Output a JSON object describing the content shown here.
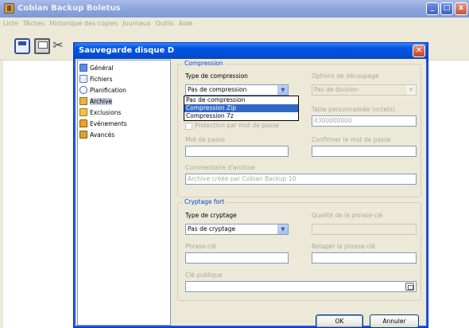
{
  "app": {
    "title": "Cobian Backup Boletus",
    "menu": [
      "Liste",
      "Tâches",
      "Historique des copies",
      "Journaux",
      "Outils",
      "Aide"
    ],
    "window_buttons": [
      "_",
      "□",
      "x"
    ]
  },
  "dialog": {
    "title": "Sauvegarde disque D",
    "close_glyph": "✕",
    "nav": [
      {
        "label": "Général",
        "icon": "general-icon"
      },
      {
        "label": "Fichiers",
        "icon": "files-icon"
      },
      {
        "label": "Planification",
        "icon": "clock-icon"
      },
      {
        "label": "Archive",
        "icon": "archive-icon",
        "selected": true
      },
      {
        "label": "Exclusions",
        "icon": "exclusions-icon"
      },
      {
        "label": "Evénements",
        "icon": "events-icon"
      },
      {
        "label": "Avancés",
        "icon": "advanced-icon"
      }
    ],
    "compression": {
      "legend": "Compression",
      "type_label": "Type de compression",
      "type_value": "Pas de compression",
      "split_label": "Options  de découpage",
      "split_value": "Pas de division",
      "dropdown_options": [
        "Pas de compression",
        "Compression Zip",
        "Compression 7z"
      ],
      "highlighted_option": "Compression Zip",
      "custom_size_label": "Taille personnalisée (octets)",
      "custom_size_value": "4300000000",
      "password_protect_label": "Protection par mot de passe",
      "password_label": "Mot de passe",
      "confirm_password_label": "Confirmer  le mot de passe",
      "comment_label": "Commentaire d'archive",
      "comment_value": "Archive créée par Cobian Backup 10"
    },
    "encryption": {
      "legend": "Cryptage fort",
      "type_label": "Type de cryptage",
      "type_value": "Pas de cryptage",
      "quality_label": "Qualité de la phrase-clé",
      "passphrase_label": "Phrase-clé",
      "retype_label": "Retaper la phrase-clé",
      "public_key_label": "Clé publique"
    },
    "buttons": {
      "ok": "OK",
      "cancel": "Annuler"
    }
  },
  "colors": {
    "accent": "#0046d5",
    "selection": "#316ac5",
    "dialog_bg": "#ece9d8"
  }
}
